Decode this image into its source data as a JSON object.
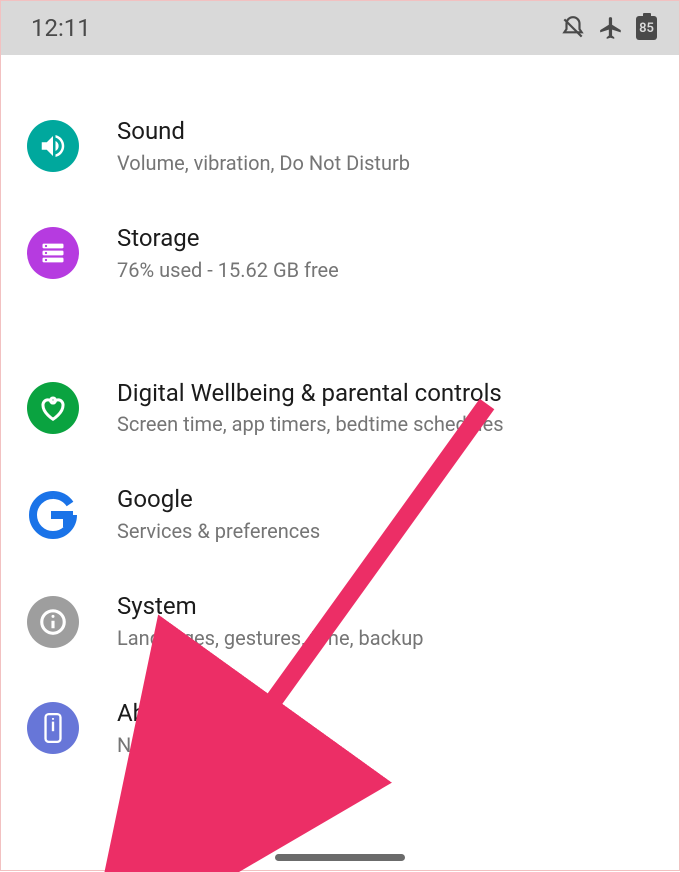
{
  "status": {
    "time": "12:11",
    "battery": "85",
    "icons": [
      "bell-off-icon",
      "airplane-icon",
      "battery-icon"
    ]
  },
  "settings": {
    "group1": [
      {
        "key": "sound",
        "icon": "volume-icon",
        "icon_bg": "bg-teal",
        "title": "Sound",
        "subtitle": "Volume, vibration, Do Not Disturb"
      },
      {
        "key": "storage",
        "icon": "storage-icon",
        "icon_bg": "bg-purple",
        "title": "Storage",
        "subtitle": "76% used - 15.62 GB free"
      }
    ],
    "group2": [
      {
        "key": "wellbeing",
        "icon": "heart-icon",
        "icon_bg": "bg-green",
        "title": "Digital Wellbeing & parental controls",
        "subtitle": "Screen time, app timers, bedtime schedules"
      },
      {
        "key": "google",
        "icon": "google-g-icon",
        "icon_bg": "bg-white",
        "title": "Google",
        "subtitle": "Services & preferences"
      },
      {
        "key": "system",
        "icon": "info-icon",
        "icon_bg": "bg-grey",
        "title": "System",
        "subtitle": "Languages, gestures, time, backup"
      },
      {
        "key": "about",
        "icon": "phone-icon",
        "icon_bg": "bg-indigo",
        "title": "About phone",
        "subtitle": "Nokia 6.1 Plus"
      }
    ]
  },
  "annotation": {
    "arrow_target": "about"
  }
}
